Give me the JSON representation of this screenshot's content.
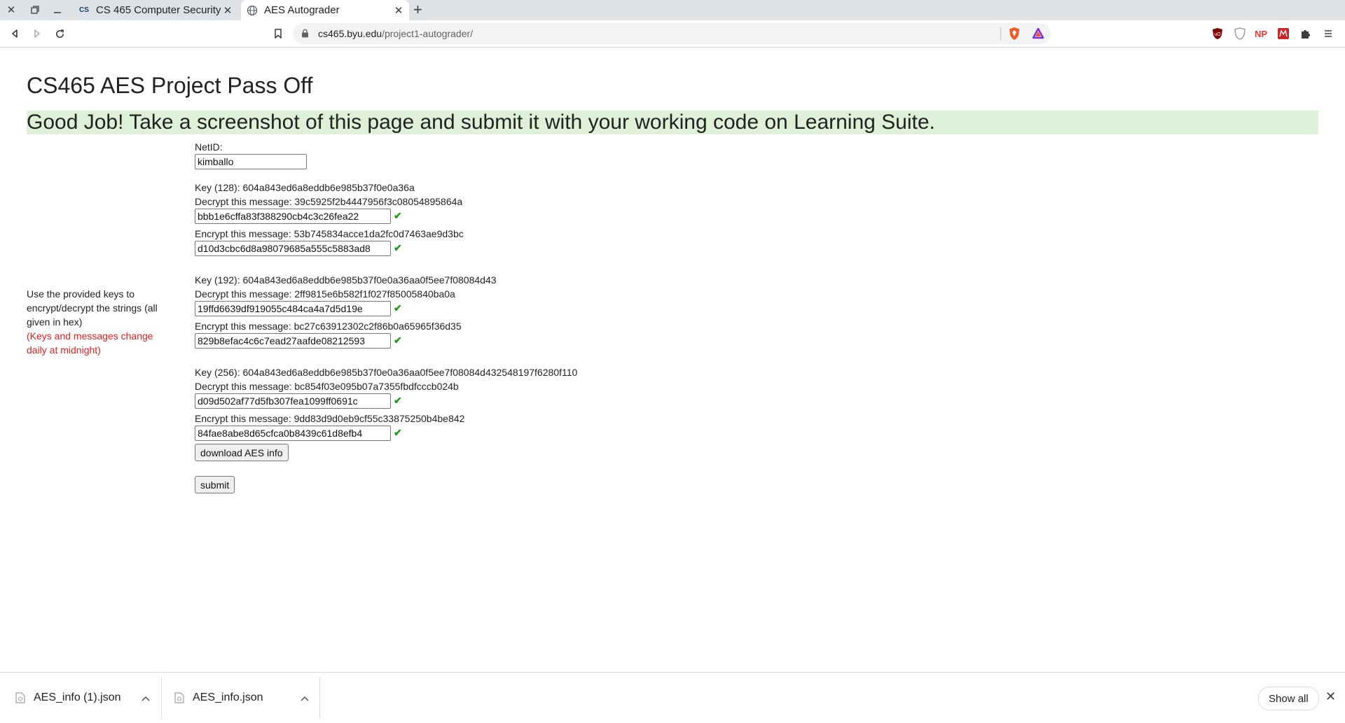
{
  "browser": {
    "tabs": [
      {
        "title": "CS 465 Computer Security",
        "favicon_text": "CS",
        "active": false
      },
      {
        "title": "AES Autograder",
        "active": true
      }
    ],
    "url_host": "cs465.byu.edu",
    "url_path": "/project1-autograder/",
    "extension_label_np": "NP"
  },
  "page": {
    "title": "CS465 AES Project Pass Off",
    "banner": "Good Job! Take a screenshot of this page and submit it with your working code on Learning Suite.",
    "instructions": "Use the provided keys to encrypt/decrypt the strings (all given in hex)",
    "instructions_note": "(Keys and messages change daily at midnight)",
    "banner_color": "#dff0d8",
    "check_color": "#1a9b1a",
    "netid_label": "NetID:",
    "netid_value": "kimballo",
    "check_mark": "✔",
    "key_sets": [
      {
        "key_label": "Key (128): 604a843ed6a8eddb6e985b37f0e0a36a",
        "decrypt_label": "Decrypt this message: 39c5925f2b4447956f3c08054895864a",
        "decrypt_value": "bbb1e6cffa83f388290cb4c3c26fea22",
        "encrypt_label": "Encrypt this message: 53b745834acce1da2fc0d7463ae9d3bc",
        "encrypt_value": "d10d3cbc6d8a98079685a555c5883ad8"
      },
      {
        "key_label": "Key (192): 604a843ed6a8eddb6e985b37f0e0a36aa0f5ee7f08084d43",
        "decrypt_label": "Decrypt this message: 2ff9815e6b582f1f027f85005840ba0a",
        "decrypt_value": "19ffd6639df919055c484ca4a7d5d19e",
        "encrypt_label": "Encrypt this message: bc27c63912302c2f86b0a65965f36d35",
        "encrypt_value": "829b8efac4c6c7ead27aafde08212593"
      },
      {
        "key_label": "Key (256): 604a843ed6a8eddb6e985b37f0e0a36aa0f5ee7f08084d432548197f6280f110",
        "decrypt_label": "Decrypt this message: bc854f03e095b07a7355fbdfcccb024b",
        "decrypt_value": "d09d502af77d5fb307fea1099ff0691c",
        "encrypt_label": "Encrypt this message: 9dd83d9d0eb9cf55c33875250b4be842",
        "encrypt_value": "84fae8abe8d65cfca0b8439c61d8efb4"
      }
    ],
    "download_button": "download AES info",
    "submit_button": "submit"
  },
  "downloads": {
    "items": [
      "AES_info (1).json",
      "AES_info.json"
    ],
    "show_all": "Show all"
  }
}
